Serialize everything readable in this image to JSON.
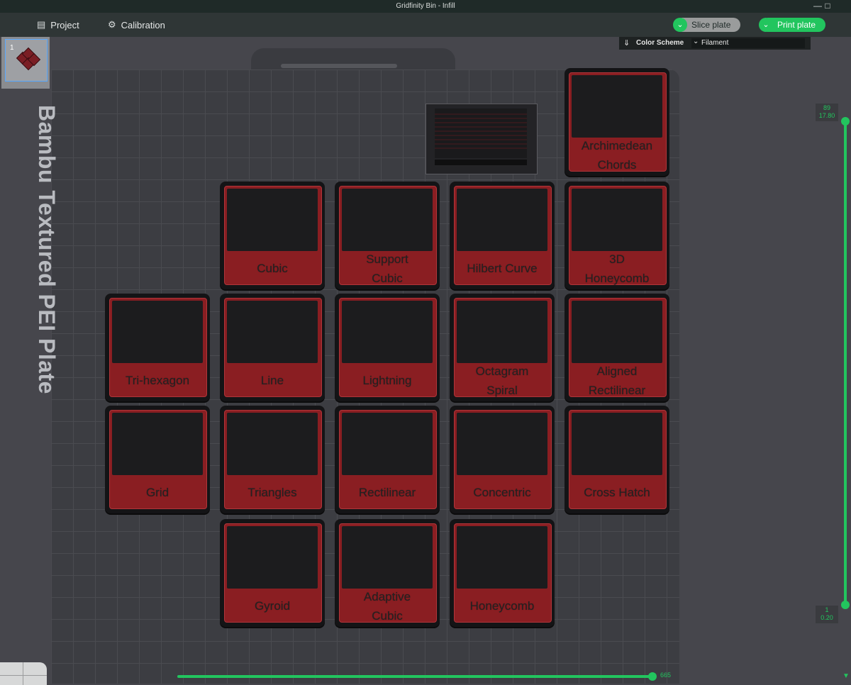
{
  "window": {
    "title": "Gridfinity Bin - Infill",
    "controls": [
      "minimize-icon",
      "maximize-icon"
    ]
  },
  "menu": {
    "project_label": "Project",
    "calibration_label": "Calibration",
    "slice_label": "Slice plate",
    "print_label": "Print plate"
  },
  "plate_thumbnail": {
    "number": "1"
  },
  "color_scheme": {
    "label": "Color Scheme",
    "value": "Filament"
  },
  "plate": {
    "label": "Bambu Textured PEI Plate"
  },
  "tiles": {
    "archimedean": "Archimedean Chords",
    "cubic": "Cubic",
    "support_cubic": "Support Cubic",
    "hilbert": "Hilbert Curve",
    "honeycomb3d": "3D Honeycomb",
    "trihexagon": "Tri-hexagon",
    "line": "Line",
    "lightning": "Lightning",
    "octagram": "Octagram Spiral",
    "aligned": "Aligned Rectilinear",
    "grid": "Grid",
    "triangles": "Triangles",
    "rectilinear": "Rectilinear",
    "concentric": "Concentric",
    "crosshatch": "Cross Hatch",
    "gyroid": "Gyroid",
    "adaptive": "Adaptive Cubic",
    "honeycomb": "Honeycomb"
  },
  "layer_slider": {
    "top_layer": "89",
    "top_height": "17.80",
    "bottom_layer": "1",
    "bottom_height": "0.20"
  },
  "move_slider": {
    "value": "665"
  },
  "colors": {
    "accent": "#22c55e",
    "tile_red": "#8a1e22",
    "plate_bg": "#3c3d42"
  }
}
